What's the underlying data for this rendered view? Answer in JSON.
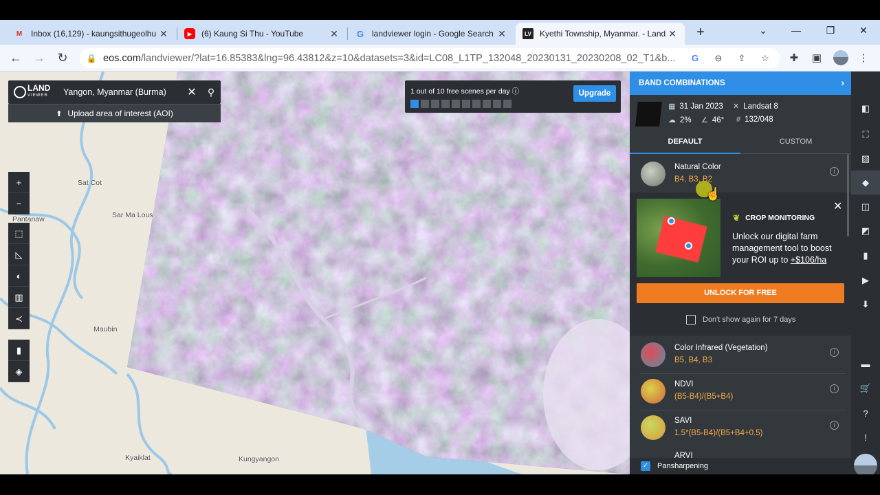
{
  "browser": {
    "tabs": [
      {
        "title": "Inbox (16,129) - kaungsithugeolhu",
        "favicon": "gmail-icon"
      },
      {
        "title": "(6) Kaung Si Thu - YouTube",
        "favicon": "youtube-icon"
      },
      {
        "title": "landviewer login - Google Search",
        "favicon": "google-icon"
      },
      {
        "title": "Kyethi Township, Myanmar. - Land",
        "favicon": "landviewer-icon"
      }
    ],
    "url_host": "eos.com",
    "url_path": "/landviewer/?lat=16.85383&lng=96.43812&z=10&datasets=3&id=LC08_L1TP_132048_20230131_20230208_02_T1&b..."
  },
  "map": {
    "search_value": "Yangon, Myanmar (Burma)",
    "upload_aoi": "Upload area of interest (AOI)",
    "logo_main": "LAND",
    "logo_sub": "VIEWER",
    "places": [
      "Sat Cot",
      "Pantanaw",
      "Sar Ma Lous",
      "Maubin",
      "Kyaiklat",
      "Kungyangon"
    ],
    "quota_text": "1 out of 10 free scenes per day",
    "quota_used": 1,
    "quota_total": 10,
    "upgrade_label": "Upgrade"
  },
  "panel": {
    "title": "BAND COMBINATIONS",
    "date": "31 Jan 2023",
    "satellite": "Landsat 8",
    "cloud": "2%",
    "sun_angle": "46°",
    "path_row": "132/048",
    "tab_default": "DEFAULT",
    "tab_custom": "CUSTOM",
    "bands": [
      {
        "name": "Natural Color",
        "formula": "B4, B3, B2"
      },
      {
        "name": "Color Infrared (Vegetation)",
        "formula": "B5, B4, B3"
      },
      {
        "name": "NDVI",
        "formula": "(B5-B4)/(B5+B4)"
      },
      {
        "name": "SAVI",
        "formula": "1.5*(B5-B4)/(B5+B4+0.5)"
      },
      {
        "name": "ARVI"
      }
    ],
    "promo": {
      "heading": "CROP MONITORING",
      "text_1": "Unlock our digital farm management tool to boost your ROI up to ",
      "text_link": "+$106/ha",
      "button": "UNLOCK FOR FREE",
      "dont_show": "Don't show again for 7 days"
    },
    "pansharpening": "Pansharpening",
    "pansharpening_checked": true
  },
  "colors": {
    "accent": "#2f8fe6",
    "orange": "#f07c22",
    "panel_bg": "#33383d"
  }
}
